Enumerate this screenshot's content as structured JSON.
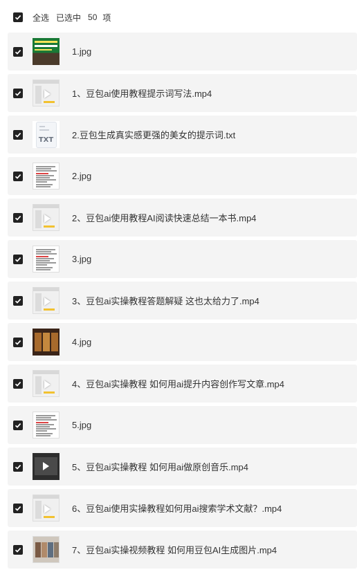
{
  "header": {
    "select_all_label": "全选",
    "selected_prefix": "已选中",
    "selected_count": "50",
    "selected_suffix": "项"
  },
  "files": [
    {
      "name": "1.jpg",
      "thumb": "image-green-cover"
    },
    {
      "name": "1、豆包ai使用教程提示词写法.mp4",
      "thumb": "video"
    },
    {
      "name": "2.豆包生成真实感更强的美女的提示词.txt",
      "thumb": "txt-file"
    },
    {
      "name": "2.jpg",
      "thumb": "image-document"
    },
    {
      "name": "2、豆包ai使用教程AI阅读快速总结一本书.mp4",
      "thumb": "video"
    },
    {
      "name": "3.jpg",
      "thumb": "image-document"
    },
    {
      "name": "3、豆包ai实操教程答题解疑 这也太给力了.mp4",
      "thumb": "video"
    },
    {
      "name": "4.jpg",
      "thumb": "image-movie-poster"
    },
    {
      "name": "4、豆包ai实操教程 如何用ai提升内容创作写文章.mp4",
      "thumb": "video"
    },
    {
      "name": "5.jpg",
      "thumb": "image-document"
    },
    {
      "name": "5、豆包ai实操教程 如何用ai做原创音乐.mp4",
      "thumb": "video-dark"
    },
    {
      "name": "6、豆包ai使用实操教程如何用ai搜索学术文献？.mp4",
      "thumb": "video"
    },
    {
      "name": "7、豆包ai实操视频教程 如何用豆包AI生成图片.mp4",
      "thumb": "image-photos"
    }
  ],
  "txt_icon_label": "TXT",
  "colors": {
    "checkbox": "#222222",
    "row_bg": "#f4f4f4",
    "text": "#333333"
  }
}
